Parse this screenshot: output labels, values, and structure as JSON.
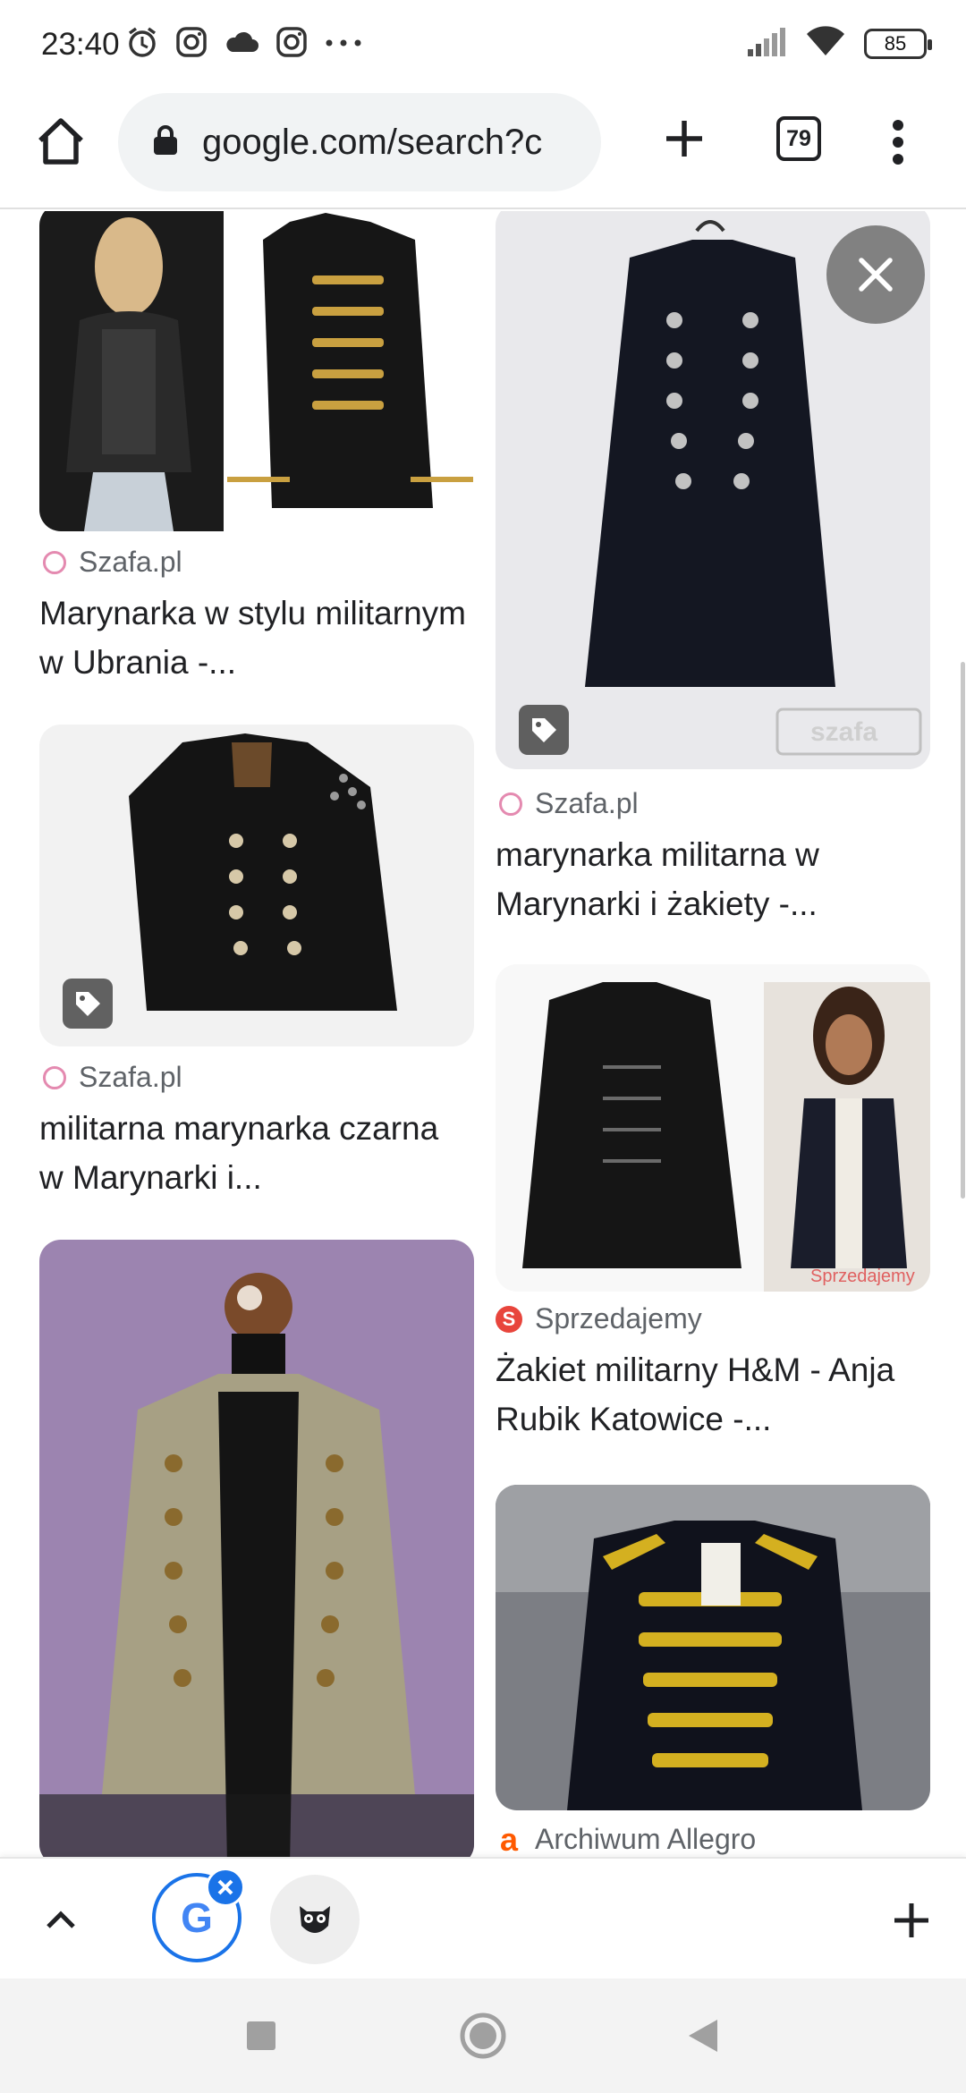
{
  "status_bar": {
    "time": "23:40",
    "battery": "85",
    "icons": [
      "alarm-icon",
      "instagram-icon",
      "cloud-icon",
      "instagram-icon",
      "more-dots-icon",
      "signal-icon",
      "wifi-icon"
    ]
  },
  "toolbar": {
    "url": "google.com/search?c",
    "tab_count": "79"
  },
  "results": [
    {
      "source": "Szafa.pl",
      "title": "Marynarka w stylu militarnym w Ubrania -...",
      "favicon": "szafa",
      "has_tag": false
    },
    {
      "source": "Szafa.pl",
      "title": "marynarka militarna w Marynarki i żakiety -...",
      "favicon": "szafa",
      "has_tag": true
    },
    {
      "source": "Szafa.pl",
      "title": "militarna marynarka czarna w Marynarki i...",
      "favicon": "szafa",
      "has_tag": true
    },
    {
      "source": "Sprzedajemy",
      "title": "Żakiet militarny H&M - Anja Rubik Katowice -...",
      "favicon": "sprzedajemy",
      "has_tag": false
    },
    {
      "source": "Archiwum Allegro",
      "title": "",
      "favicon": "allegro",
      "has_tag": false
    },
    {
      "source": "",
      "title": "",
      "favicon": "",
      "has_tag": false
    }
  ],
  "watermarks": {
    "szafa": "szafa",
    "sprzedajemy": "Sprzedajemy"
  },
  "tab_strip": {
    "google_letter": "G"
  },
  "colors": {
    "accent": "#1a73e8",
    "link_text": "#202124",
    "source_text": "#5f6368"
  }
}
